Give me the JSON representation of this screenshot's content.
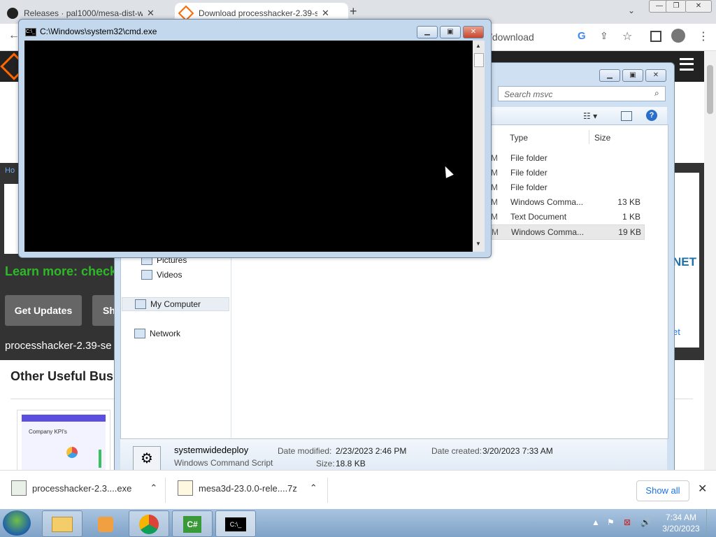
{
  "browser": {
    "tabs": [
      {
        "label": "Releases · pal1000/mesa-dist-wi",
        "close": "✕"
      },
      {
        "label": "Download processhacker-2.39-se",
        "close": "✕"
      }
    ],
    "new_tab": "+",
    "url_tail": "/download",
    "window_min": "—",
    "window_max": "❐",
    "window_close": "✕"
  },
  "page": {
    "learn_more": "Learn more: check",
    "breadcrumb_start": "Ho",
    "get_updates": "Get Updates",
    "share": "Sh",
    "filename": "processhacker-2.39-se",
    "other_useful": "Other Useful Busin",
    "kpi_label": "Company KPI's",
    "right_partial_1": "NET",
    "right_partial_2": "et"
  },
  "downloads": {
    "items": [
      {
        "name": "processhacker-2.3....exe"
      },
      {
        "name": "mesa3d-23.0.0-rele....7z"
      }
    ],
    "show_all": "Show all",
    "close": "✕"
  },
  "cmd": {
    "title": "C:\\Windows\\system32\\cmd.exe",
    "icon_text": "C:\\_"
  },
  "explorer": {
    "search_placeholder": "Search msvc",
    "columns": {
      "type": "Type",
      "size": "Size"
    },
    "rows": [
      {
        "m": "M",
        "type": "File folder",
        "size": ""
      },
      {
        "m": "M",
        "type": "File folder",
        "size": ""
      },
      {
        "m": "M",
        "type": "File folder",
        "size": ""
      },
      {
        "m": "M",
        "type": "Windows Comma...",
        "size": "13 KB"
      },
      {
        "m": "M",
        "type": "Text Document",
        "size": "1 KB"
      },
      {
        "m": "M",
        "type": "Windows Comma...",
        "size": "19 KB"
      }
    ],
    "nav": {
      "pictures": "Pictures",
      "videos": "Videos",
      "my_computer": "My Computer",
      "network": "Network"
    },
    "details": {
      "name": "systemwidedeploy",
      "kind": "Windows Command Script",
      "modified_label": "Date modified:",
      "modified_value": "2/23/2023 2:46 PM",
      "created_label": "Date created:",
      "created_value": "3/20/2023 7:33 AM",
      "size_label": "Size:",
      "size_value": "18.8 KB"
    }
  },
  "taskbar": {
    "time": "7:34 AM",
    "date": "3/20/2023",
    "cmd_icon": "C:\\_",
    "csharp_icon": "C#"
  }
}
